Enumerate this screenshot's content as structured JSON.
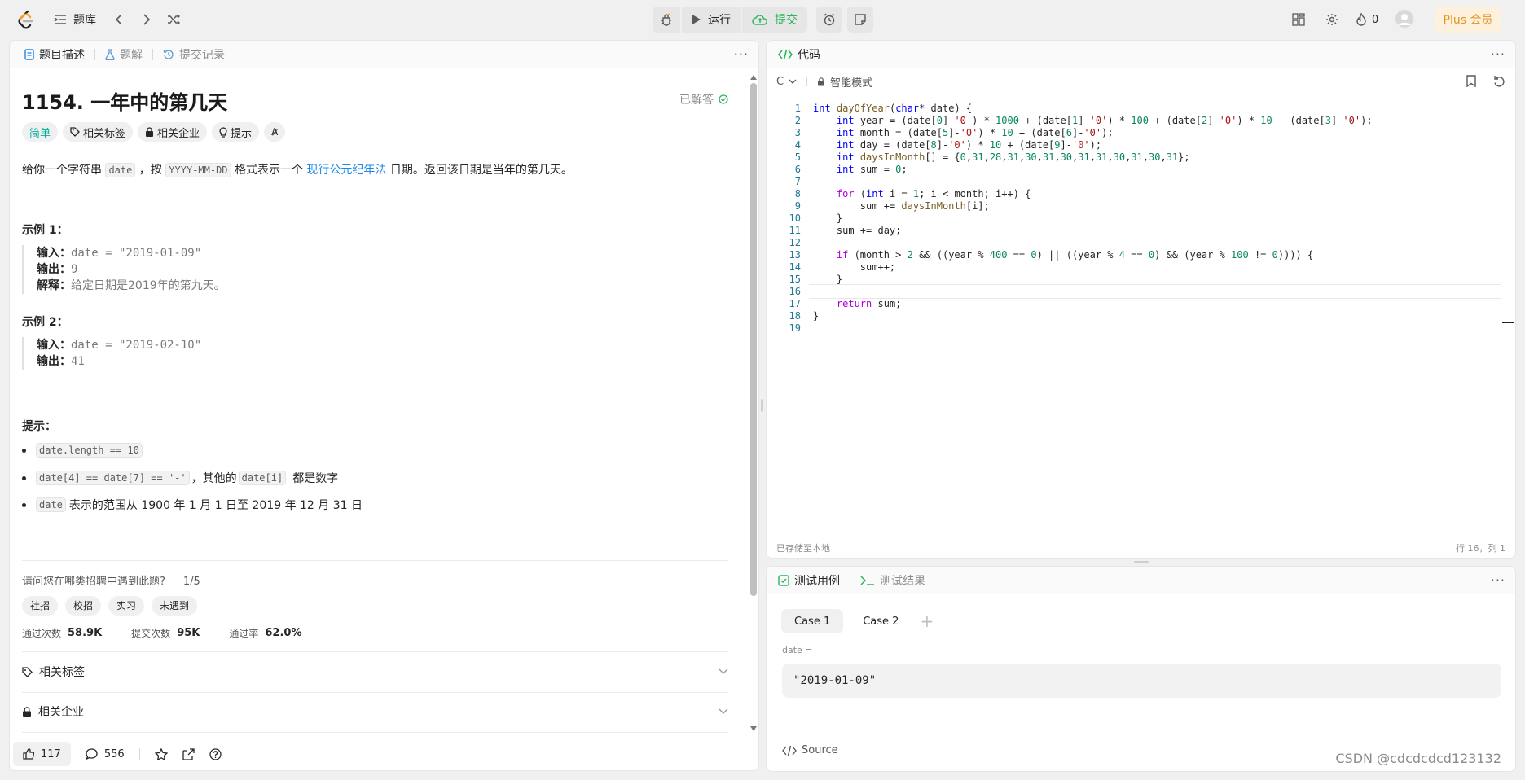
{
  "topbar": {
    "problem_list_label": "题库",
    "run_label": "运行",
    "submit_label": "提交",
    "streak_count": "0",
    "plus_label": "Plus 会员"
  },
  "left": {
    "tabs": [
      {
        "label": "题目描述",
        "active": true
      },
      {
        "label": "题解",
        "active": false
      },
      {
        "label": "提交记录",
        "active": false
      }
    ],
    "title": "1154. 一年中的第几天",
    "solved_label": "已解答",
    "tags": [
      {
        "label": "简单",
        "icon": ""
      },
      {
        "label": "相关标签",
        "icon": "tag-icon"
      },
      {
        "label": "相关企业",
        "icon": "lock-icon"
      },
      {
        "label": "提示",
        "icon": "lightbulb-icon"
      }
    ],
    "desc": {
      "p1_a": "给你一个字符串 ",
      "p1_code1": "date",
      "p1_b": " ，按 ",
      "p1_code2": "YYYY-MM-DD",
      "p1_c": " 格式表示一个 ",
      "p1_link": "现行公元纪年法",
      "p1_d": " 日期。返回该日期是当年的第几天。"
    },
    "examples": [
      {
        "heading": "示例 1：",
        "rows": [
          {
            "k": "输入：",
            "v": "date = \"2019-01-09\"",
            "mono": true
          },
          {
            "k": "输出：",
            "v": "9",
            "mono": true
          },
          {
            "k": "解释：",
            "v": "给定日期是2019年的第九天。",
            "mono": false
          }
        ]
      },
      {
        "heading": "示例 2：",
        "rows": [
          {
            "k": "输入：",
            "v": "date = \"2019-02-10\"",
            "mono": true
          },
          {
            "k": "输出：",
            "v": "41",
            "mono": true
          }
        ]
      }
    ],
    "hints_heading": "提示：",
    "hints": {
      "h1_code": "date.length == 10",
      "h2_code": "date[4] == date[7] == '-'",
      "h2_text1": "，其他的",
      "h2_code2": "date[i]",
      "h2_text2": "都是数字",
      "h3_code": "date",
      "h3_text": "表示的范围从 1900 年 1 月 1 日至 2019 年 12 月 31 日"
    },
    "survey_question": "请问您在哪类招聘中遇到此题?",
    "survey_progress": "1/5",
    "survey_chips": [
      "社招",
      "校招",
      "实习",
      "未遇到"
    ],
    "stats": [
      {
        "label": "通过次数",
        "value": "58.9K"
      },
      {
        "label": "提交次数",
        "value": "95K"
      },
      {
        "label": "通过率",
        "value": "62.0%"
      }
    ],
    "accordion": [
      {
        "label": "相关标签",
        "icon": "tag-icon"
      },
      {
        "label": "相关企业",
        "icon": "lock-icon"
      }
    ],
    "footer": {
      "likes": "117",
      "comments": "556"
    }
  },
  "editor": {
    "tab_label": "代码",
    "language": "C",
    "mode_label": "智能模式",
    "status_left": "已存储至本地",
    "status_right": "行 16，列 1",
    "lines": [
      "int dayOfYear(char* date) {",
      "    int year = (date[0]-'0') * 1000 + (date[1]-'0') * 100 + (date[2]-'0') * 10 + (date[3]-'0');",
      "    int month = (date[5]-'0') * 10 + (date[6]-'0');",
      "    int day = (date[8]-'0') * 10 + (date[9]-'0');",
      "    int daysInMonth[] = {0,31,28,31,30,31,30,31,31,30,31,30,31};",
      "    int sum = 0;",
      "",
      "    for (int i = 1; i < month; i++) {",
      "        sum += daysInMonth[i];",
      "    }",
      "    sum += day;",
      "",
      "    if (month > 2 && ((year % 400 == 0) || ((year % 4 == 0) && (year % 100 != 0)))) {",
      "        sum++;",
      "    }",
      "",
      "    return sum;",
      "}",
      ""
    ]
  },
  "tests": {
    "tabs": [
      {
        "label": "测试用例",
        "active": true
      },
      {
        "label": "测试结果",
        "active": false
      }
    ],
    "cases": [
      "Case 1",
      "Case 2"
    ],
    "param_label": "date =",
    "param_value": "\"2019-01-09\"",
    "source_label": "Source"
  },
  "watermark": "CSDN @cdcdcdcd123132"
}
